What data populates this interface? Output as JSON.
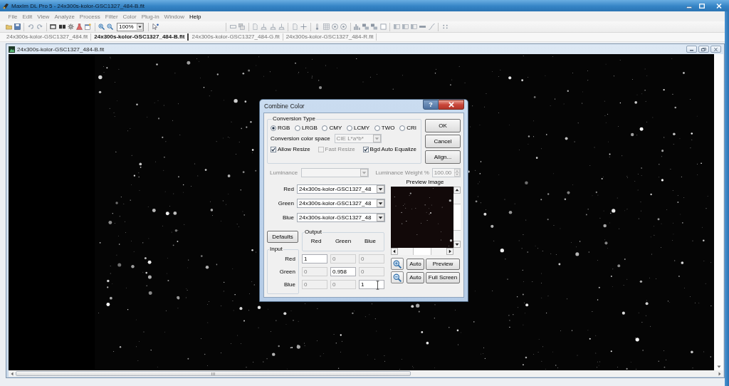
{
  "window": {
    "title": "MaxIm DL Pro 5 - 24x300s-kolor-GSC1327_484-B.fit"
  },
  "menu": [
    {
      "label": "File",
      "disabled": true
    },
    {
      "label": "Edit",
      "disabled": true
    },
    {
      "label": "View",
      "disabled": true
    },
    {
      "label": "Analyze",
      "disabled": true
    },
    {
      "label": "Process",
      "disabled": true
    },
    {
      "label": "Filter",
      "disabled": true
    },
    {
      "label": "Color",
      "disabled": true
    },
    {
      "label": "Plug-in",
      "disabled": true
    },
    {
      "label": "Window",
      "disabled": true
    },
    {
      "label": "Help",
      "disabled": false
    }
  ],
  "toolbar": {
    "zoom": "100%"
  },
  "document_tabs": [
    {
      "label": "24x300s-kolor-GSC1327_484.fit",
      "selected": false
    },
    {
      "label": "24x300s-kolor-GSC1327_484-B.fit",
      "selected": true
    },
    {
      "label": "24x300s-kolor-GSC1327_484-G.fit",
      "selected": false
    },
    {
      "label": "24x300s-kolor-GSC1327_484-R.fit",
      "selected": false
    }
  ],
  "image_window": {
    "title": "24x300s-kolor-GSC1327_484-B.fit"
  },
  "dialog": {
    "title": "Combine Color",
    "help": "?",
    "conversion_type": {
      "legend": "Conversion Type",
      "options": [
        {
          "label": "RGB",
          "selected": true
        },
        {
          "label": "LRGB",
          "selected": false
        },
        {
          "label": "CMY",
          "selected": false
        },
        {
          "label": "LCMY",
          "selected": false
        },
        {
          "label": "TWO",
          "selected": false
        },
        {
          "label": "CRI",
          "selected": false
        }
      ]
    },
    "color_space": {
      "label": "Conversion color space",
      "value": "CIE L*a*b*",
      "disabled": true
    },
    "checkboxes": [
      {
        "label": "Allow Resize",
        "checked": true,
        "disabled": false
      },
      {
        "label": "Fast Resize",
        "checked": false,
        "disabled": true
      },
      {
        "label": "Bgd Auto Equalize",
        "checked": true,
        "disabled": false
      }
    ],
    "buttons": [
      "OK",
      "Cancel",
      "Align..."
    ],
    "luminance": {
      "label": "Luminance",
      "disabled": true
    },
    "luminance_weight": {
      "label": "Luminance Weight %",
      "value": "100.00",
      "disabled": true
    },
    "channels": [
      {
        "label": "Red",
        "value": "24x300s-kolor-GSC1327_48"
      },
      {
        "label": "Green",
        "value": "24x300s-kolor-GSC1327_48"
      },
      {
        "label": "Blue",
        "value": "24x300s-kolor-GSC1327_48"
      }
    ],
    "defaults": "Defaults",
    "output": {
      "legend": "Output",
      "columns": [
        "Red",
        "Green",
        "Blue"
      ]
    },
    "input": {
      "legend": "Input",
      "rows": [
        {
          "label": "Red",
          "values": [
            {
              "value": "1",
              "disabled": false
            },
            {
              "value": "0",
              "disabled": true
            },
            {
              "value": "0",
              "disabled": true
            }
          ]
        },
        {
          "label": "Green",
          "values": [
            {
              "value": "0",
              "disabled": true
            },
            {
              "value": "0.958",
              "disabled": false
            },
            {
              "value": "0",
              "disabled": true
            }
          ]
        },
        {
          "label": "Blue",
          "values": [
            {
              "value": "0",
              "disabled": true
            },
            {
              "value": "0",
              "disabled": true
            },
            {
              "value": "1",
              "disabled": false
            }
          ]
        }
      ]
    },
    "preview": {
      "label": "Preview Image",
      "rows": [
        {
          "auto": "Auto",
          "action": "Preview"
        },
        {
          "auto": "Auto",
          "action": "Full Screen"
        }
      ]
    }
  }
}
